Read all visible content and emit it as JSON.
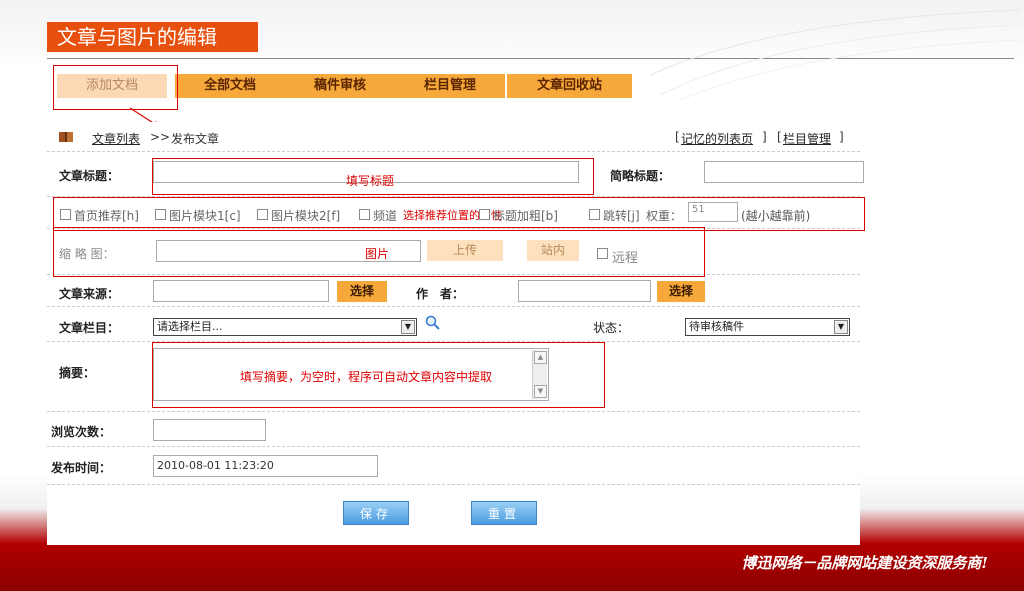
{
  "page_title": "文章与图片的编辑",
  "tabs": [
    {
      "label": "添加文档"
    },
    {
      "label": "全部文档"
    },
    {
      "label": "稿件审核"
    },
    {
      "label": "栏目管理"
    },
    {
      "label": "文章回收站"
    }
  ],
  "breadcrumb": {
    "list_link": "文章列表",
    "separator": ">>",
    "current": "发布文章",
    "right_link1": "记忆的列表页",
    "right_link2": "栏目管理"
  },
  "form": {
    "title_label": "文章标题：",
    "title_hint": "填写标题",
    "short_title_label": "简略标题：",
    "flags": [
      {
        "label": "首页推荐[h]"
      },
      {
        "label": "图片模块1[c]"
      },
      {
        "label": "图片模块2[f]"
      },
      {
        "label": "频道"
      },
      {
        "label": "标题加粗[b]"
      },
      {
        "label": "跳转[j]"
      }
    ],
    "flags_hint": "选择推荐位置的属性",
    "weight_label": "权重：",
    "weight_value": "51",
    "weight_note": "(越小越靠前)",
    "thumb_label": "缩 略 图：",
    "thumb_hint": "图片",
    "upload_button": "上传",
    "site_button": "站内",
    "remote_label": "远程",
    "source_label": "文章来源：",
    "select_button": "选择",
    "author_label": "作　者：",
    "column_label": "文章栏目：",
    "column_placeholder": "请选择栏目...",
    "status_label": "状态：",
    "status_value": "待审核稿件",
    "summary_label": "摘要：",
    "summary_hint": "填写摘要，为空时，程序可自动文章内容中提取",
    "views_label": "浏览次数：",
    "views_value": "",
    "pubtime_label": "发布时间：",
    "pubtime_value": "2010-08-01 11:23:20",
    "save_button": "保存",
    "reset_button": "重置"
  },
  "footer": {
    "slogan": "博迅网络－品牌网站建设资深服务商!"
  },
  "colors": {
    "accent": "#e8500f",
    "tab_bg": "#f6a93a",
    "highlight": "#dd0000"
  }
}
